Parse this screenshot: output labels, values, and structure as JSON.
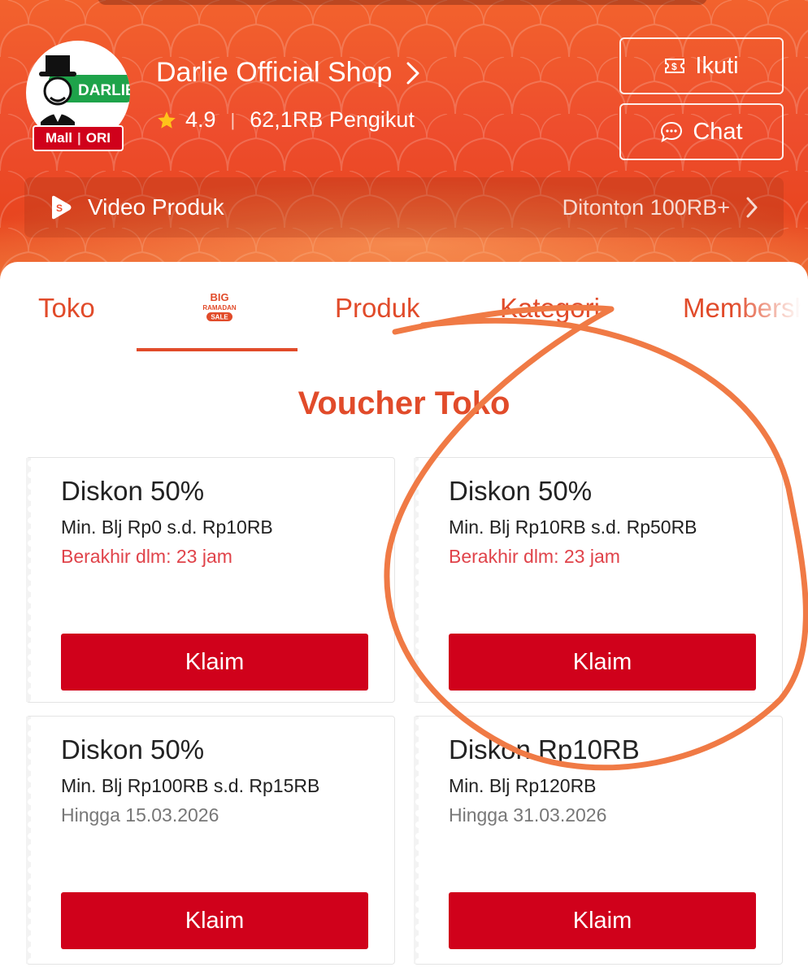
{
  "colors": {
    "brand": "#ee4d2d",
    "accent_text": "#e14b2a",
    "claim_button": "#d0011b",
    "expiry_red": "#e0434a",
    "annotation_stroke": "#f07a45"
  },
  "shop": {
    "logo_text": "DARLIE",
    "logo_badge_left": "Mall",
    "logo_badge_right": "ORI",
    "name": "Darlie Official Shop",
    "rating": "4.9",
    "followers": "62,1RB Pengikut"
  },
  "actions": {
    "follow_label": "Ikuti",
    "chat_label": "Chat"
  },
  "video": {
    "label": "Video Produk",
    "views": "Ditonton 100RB+"
  },
  "tabs": [
    {
      "label": "Toko"
    },
    {
      "label": "BIG RAMADAN SALE",
      "lines": [
        "BIG",
        "RAMADAN",
        "SALE"
      ],
      "active": true
    },
    {
      "label": "Produk"
    },
    {
      "label": "Kategori"
    },
    {
      "label": "Membership"
    }
  ],
  "section_title": "Voucher Toko",
  "vouchers": [
    {
      "title": "Diskon 50%",
      "min_spend": "Min. Blj Rp0 s.d. Rp10RB",
      "expiry": "Berakhir dlm: 23 jam",
      "button": "Klaim"
    },
    {
      "title": "Diskon 50%",
      "min_spend": "Min. Blj Rp10RB s.d. Rp50RB",
      "expiry": "Berakhir dlm: 23 jam",
      "button": "Klaim"
    },
    {
      "title": "Diskon 50%",
      "min_spend": "Min. Blj Rp100RB s.d. Rp15RB",
      "expiry": "Hingga 15.03.2026",
      "button": "Klaim"
    },
    {
      "title": "Diskon Rp10RB",
      "min_spend": "Min. Blj Rp120RB",
      "expiry": "Hingga 31.03.2026",
      "button": "Klaim"
    }
  ]
}
